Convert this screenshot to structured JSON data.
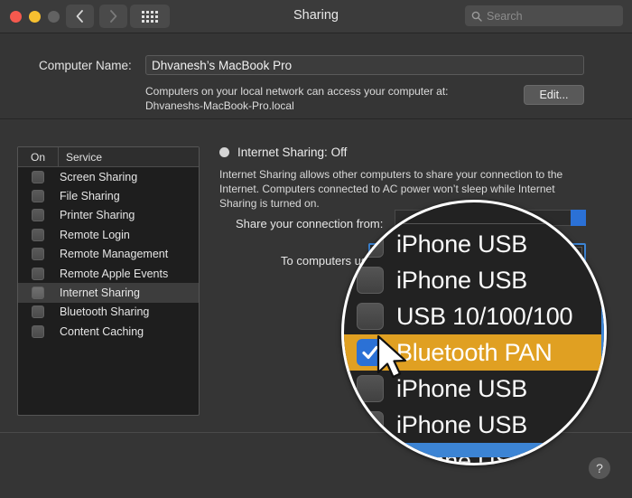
{
  "window": {
    "title": "Sharing",
    "traffic_lights": [
      "close",
      "minimize",
      "zoom"
    ],
    "nav": {
      "back_icon": "chevron-left-icon",
      "forward_icon": "chevron-right-icon",
      "grid_icon": "grid-view-icon"
    }
  },
  "search": {
    "placeholder": "Search",
    "icon": "search-icon"
  },
  "computer_name": {
    "label": "Computer Name:",
    "value": "Dhvanesh’s MacBook Pro",
    "access_line1": "Computers on your local network can access your computer at:",
    "access_line2": "Dhvaneshs-MacBook-Pro.local",
    "edit_label": "Edit..."
  },
  "service_list": {
    "columns": [
      "On",
      "Service"
    ],
    "rows": [
      {
        "name": "Screen Sharing",
        "checked": false,
        "selected": false
      },
      {
        "name": "File Sharing",
        "checked": false,
        "selected": false
      },
      {
        "name": "Printer Sharing",
        "checked": false,
        "selected": false
      },
      {
        "name": "Remote Login",
        "checked": false,
        "selected": false
      },
      {
        "name": "Remote Management",
        "checked": false,
        "selected": false
      },
      {
        "name": "Remote Apple Events",
        "checked": false,
        "selected": false
      },
      {
        "name": "Internet Sharing",
        "checked": false,
        "selected": true
      },
      {
        "name": "Bluetooth Sharing",
        "checked": false,
        "selected": false
      },
      {
        "name": "Content Caching",
        "checked": false,
        "selected": false
      }
    ]
  },
  "detail": {
    "status_label": "Internet Sharing: Off",
    "status_indicator": "status-dot-off",
    "description": "Internet Sharing allows other computers to share your connection to the Internet. Computers connected to AC power won’t sleep while Internet Sharing is turned on.",
    "share_from_label": "Share your connection from:",
    "to_computers_label": "To computers using:",
    "share_from_value": "iPhone USB"
  },
  "magnifier": {
    "list_items": [
      {
        "label": "iPhone USB",
        "checked": false,
        "highlighted": false
      },
      {
        "label": "iPhone USB",
        "checked": false,
        "highlighted": false
      },
      {
        "label": "USB 10/100/100",
        "checked": false,
        "highlighted": false
      },
      {
        "label": "Bluetooth PAN",
        "checked": true,
        "highlighted": true
      },
      {
        "label": "iPhone USB",
        "checked": false,
        "highlighted": false
      },
      {
        "label": "iPhone USB",
        "checked": false,
        "highlighted": false
      },
      {
        "label": "iPhone USB",
        "checked": false,
        "highlighted": false
      }
    ],
    "cursor": "arrow-pointer-icon"
  },
  "footer": {
    "help_label": "?"
  },
  "colors": {
    "window_bg": "#353535",
    "list_bg": "#1e1e1e",
    "highlight_orange": "#e0a022",
    "accent_blue": "#2b71d6",
    "focus_ring_blue": "#3c84d4",
    "close": "#f5594e",
    "minimize": "#f7c030",
    "zoom": "#626262"
  }
}
